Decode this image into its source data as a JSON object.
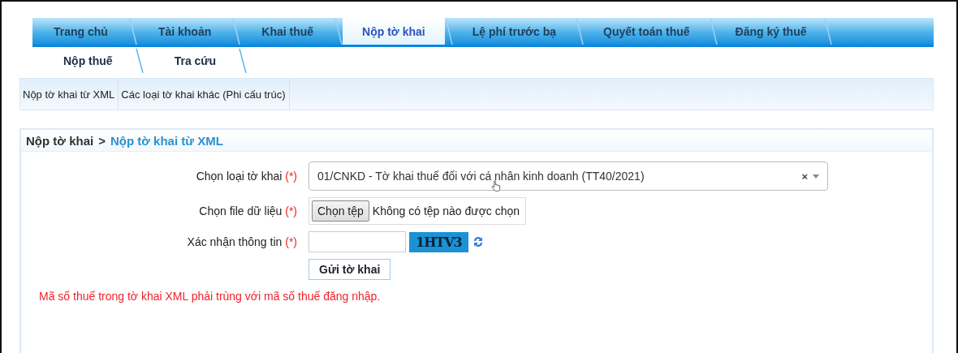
{
  "tabs": [
    {
      "label": "Trang chủ",
      "selected": false
    },
    {
      "label": "Tài khoản",
      "selected": false
    },
    {
      "label": "Khai thuế",
      "selected": false
    },
    {
      "label": "Nộp tờ khai",
      "selected": true
    },
    {
      "label": "Lệ phí trước bạ",
      "selected": false
    },
    {
      "label": "Quyết toán thuế",
      "selected": false
    },
    {
      "label": "Đăng ký thuế",
      "selected": false
    }
  ],
  "subtabs": [
    {
      "label": "Nộp thuế"
    },
    {
      "label": "Tra cứu"
    }
  ],
  "subnav": [
    {
      "label": "Nộp tờ khai từ XML"
    },
    {
      "label": "Các loại tờ khai khác (Phi cấu trúc)"
    }
  ],
  "panel": {
    "breadcrumb": {
      "parent": "Nộp tờ khai",
      "separator": ">",
      "current": "Nộp tờ khai từ XML"
    },
    "fields": [
      {
        "kind": "select",
        "label": "Chọn loại tờ khai",
        "required": "(*)",
        "value": "01/CNKD - Tờ khai thuế đối với cá nhân kinh doanh (TT40/2021)",
        "clear": "×"
      },
      {
        "kind": "file",
        "label": "Chọn file dữ liệu",
        "required": "(*)",
        "button": "Chọn tệp",
        "status": "Không có tệp nào được chọn"
      },
      {
        "kind": "captcha",
        "label": "Xác nhận thông tin",
        "required": "(*)",
        "captcha": "1HTV3"
      }
    ],
    "submit": "Gửi tờ khai",
    "note": "Mã số thuế trong tờ khai XML phải trùng với mã số thuế đăng nhập."
  }
}
